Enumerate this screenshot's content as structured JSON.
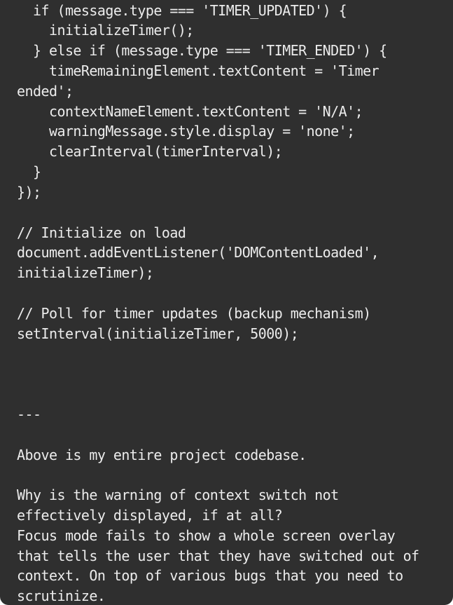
{
  "message": {
    "lines": [
      "  if (message.type === 'TIMER_UPDATED') {",
      "    initializeTimer();",
      "  } else if (message.type === 'TIMER_ENDED') {",
      "    timeRemainingElement.textContent = 'Timer",
      "ended';",
      "    contextNameElement.textContent = 'N/A';",
      "    warningMessage.style.display = 'none';",
      "    clearInterval(timerInterval);",
      "  }",
      "});",
      "",
      "// Initialize on load",
      "document.addEventListener('DOMContentLoaded',",
      "initializeTimer);",
      "",
      "// Poll for timer updates (backup mechanism)",
      "setInterval(initializeTimer, 5000);",
      "",
      "",
      "",
      "---",
      "",
      "Above is my entire project codebase.",
      "",
      "Why is the warning of context switch not",
      "effectively displayed, if at all?",
      "Focus mode fails to show a whole screen overlay",
      "that tells the user that they have switched out of",
      "context. On top of various bugs that you need to",
      "scrutinize."
    ]
  }
}
